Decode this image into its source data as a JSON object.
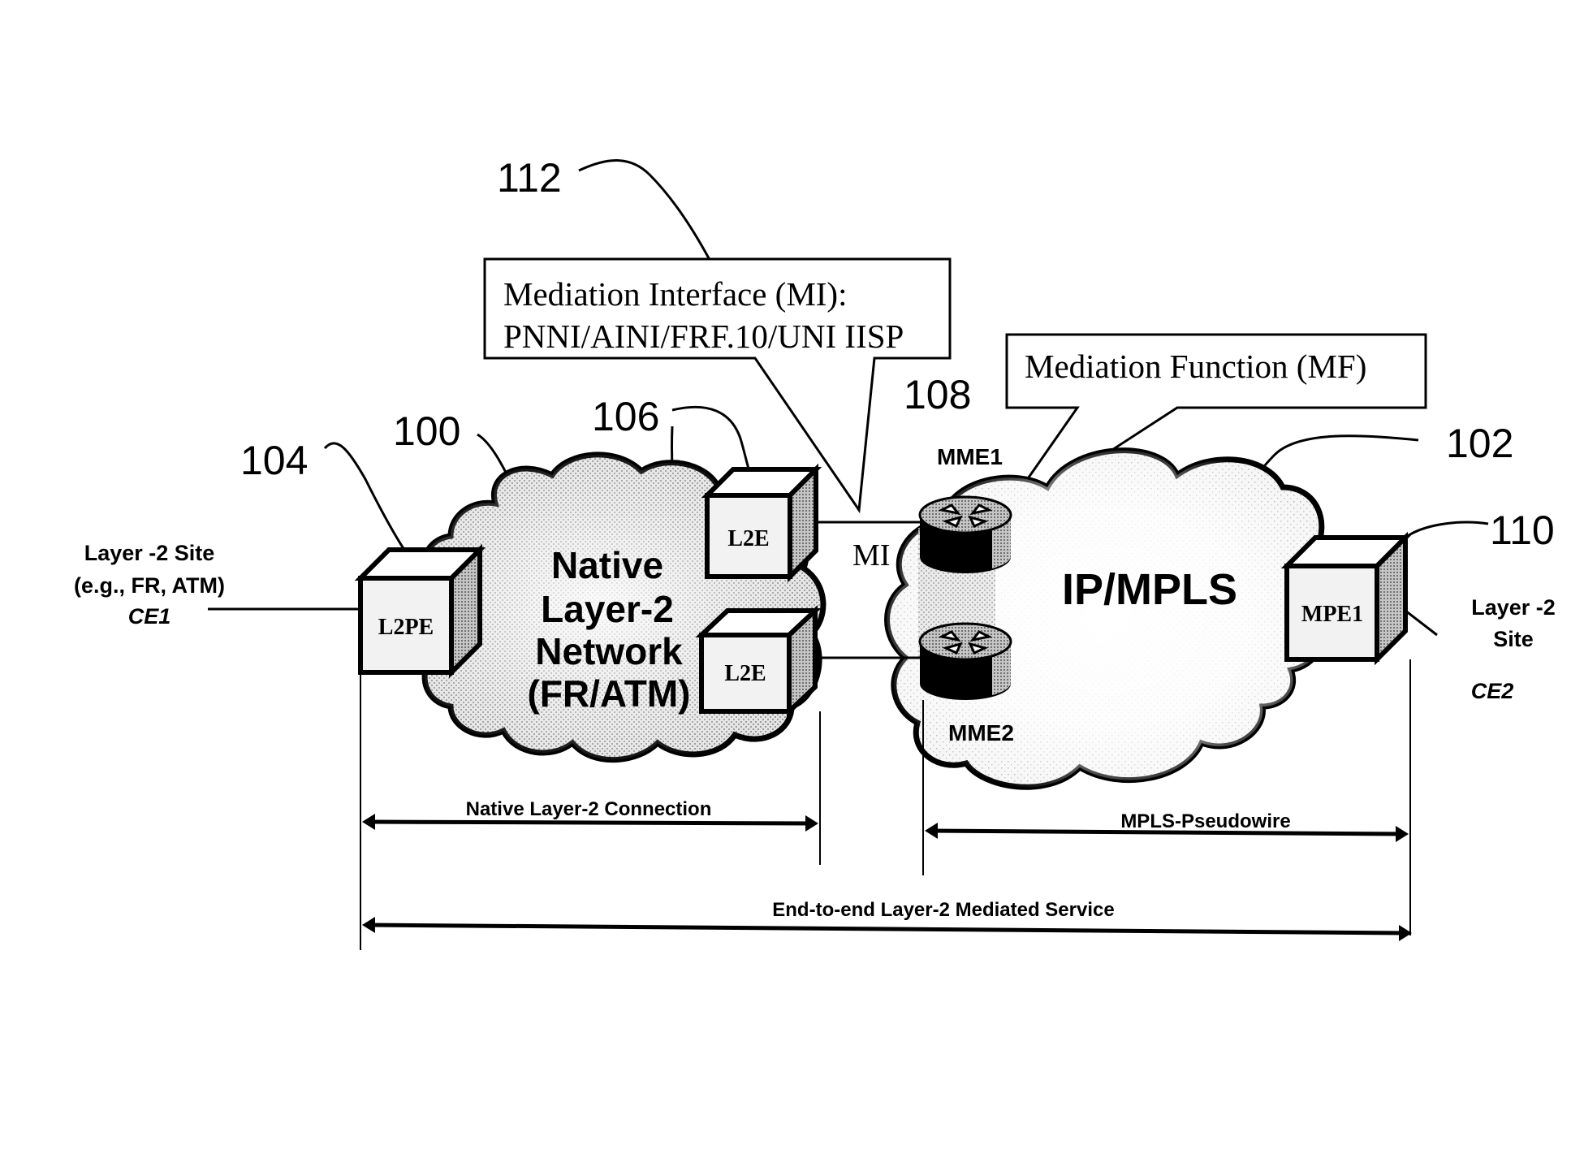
{
  "figure": {
    "reference_numerals": {
      "mediation_interface": "112",
      "native_network": "100",
      "l2pe": "104",
      "l2e": "106",
      "mediation_function": "108",
      "ip_mpls_network": "102",
      "mpe": "110"
    },
    "mediation_interface_box": {
      "line1": "Mediation Interface (MI):",
      "line2": "PNNI/AINI/FRF.10/UNI IISP"
    },
    "mediation_function_box": {
      "label": "Mediation Function (MF)"
    },
    "native_network": {
      "line1": "Native",
      "line2": "Layer-2",
      "line3": "Network",
      "line4": "(FR/ATM)"
    },
    "ip_mpls_network": {
      "label": "IP/MPLS"
    },
    "nodes": {
      "l2pe": "L2PE",
      "l2e_top": "L2E",
      "l2e_bottom": "L2E",
      "mme1": "MME1",
      "mme2": "MME2",
      "mpe1": "MPE1"
    },
    "mi_label": "MI",
    "site_left": {
      "line1": "Layer -2 Site",
      "line2": "(e.g., FR, ATM)",
      "line3": "CE1"
    },
    "site_right": {
      "line1": "Layer -2",
      "line2": "Site",
      "line3": "CE2"
    },
    "spans": {
      "native_connection": "Native Layer-2 Connection",
      "pseudowire": "MPLS-Pseudowire",
      "end_to_end": "End-to-end Layer-2 Mediated Service"
    }
  }
}
